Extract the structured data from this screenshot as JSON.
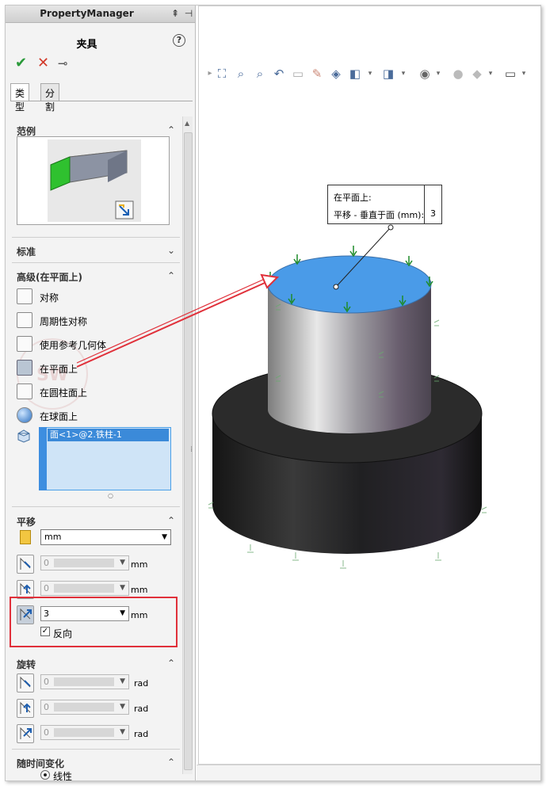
{
  "panel": {
    "header_title": "PropertyManager",
    "feature_title": "夹具",
    "help_label": "?",
    "ok_symbol": "✔",
    "cancel_symbol": "✕",
    "pin_symbol": "⊸",
    "tabs": [
      "类型",
      "分割"
    ]
  },
  "sections": {
    "example": "范例",
    "standard": "标准",
    "advanced": "高级(在平面上)",
    "translation": "平移",
    "rotation": "旋转",
    "time_variation": "随时间变化"
  },
  "advanced_items": [
    "对称",
    "周期性对称",
    "使用参考几何体",
    "在平面上",
    "在圆柱面上",
    "在球面上"
  ],
  "selected_item": "在平面上",
  "face_list": [
    "面<1>@2.铁柱-1"
  ],
  "translation": {
    "units": "mm",
    "rows": [
      {
        "value": "0",
        "unit": "mm"
      },
      {
        "value": "0",
        "unit": "mm"
      },
      {
        "value": "3",
        "unit": "mm"
      }
    ],
    "reverse_label": "反向",
    "reverse_checked": true
  },
  "rotation": {
    "rows": [
      {
        "value": "0",
        "unit": "rad"
      },
      {
        "value": "0",
        "unit": "rad"
      },
      {
        "value": "0",
        "unit": "rad"
      }
    ]
  },
  "time": {
    "option": "线性"
  },
  "callout": {
    "line1": "在平面上:",
    "line2": "平移 - 垂直于面 (mm):",
    "value": "3"
  },
  "colors": {
    "top_face": "#4a9be8",
    "highlight": "#e0303a",
    "fixture_arrow": "#1f8b2a"
  }
}
